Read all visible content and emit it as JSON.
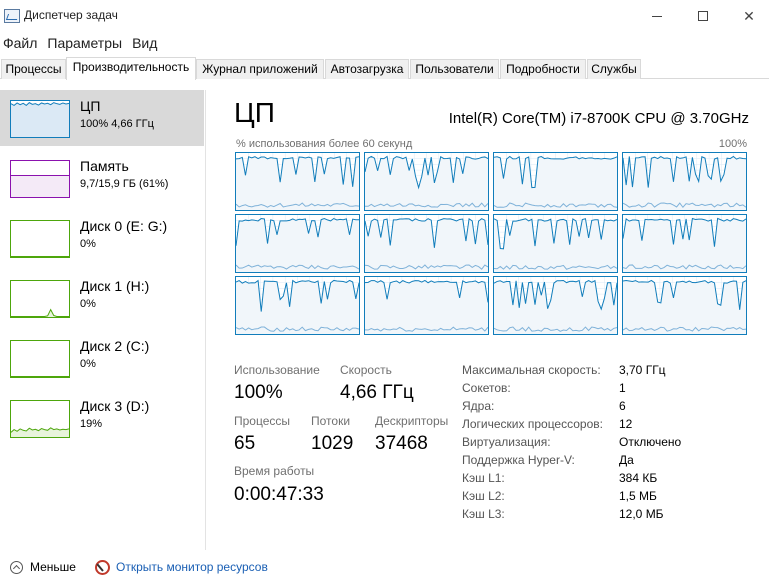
{
  "window": {
    "title": "Диспетчер задач",
    "minimize_icon": "minimize-icon",
    "maximize_icon": "maximize-icon",
    "close_icon": "close-icon",
    "close_glyph": "✕"
  },
  "menu": [
    "Файл",
    "Параметры",
    "Вид"
  ],
  "tabs": [
    {
      "label": "Процессы",
      "active": false
    },
    {
      "label": "Производительность",
      "active": true
    },
    {
      "label": "Журнал приложений",
      "active": false
    },
    {
      "label": "Автозагрузка",
      "active": false
    },
    {
      "label": "Пользователи",
      "active": false
    },
    {
      "label": "Подробности",
      "active": false
    },
    {
      "label": "Службы",
      "active": false
    }
  ],
  "sidebar": [
    {
      "title": "ЦП",
      "sub": "100% 4,66 ГГц",
      "kind": "cpu",
      "active": true,
      "color": "#117dbb",
      "trace": [
        0.95,
        0.9,
        0.97,
        0.92,
        0.96,
        0.9,
        0.98,
        0.93,
        0.95,
        0.91,
        0.97,
        0.94,
        0.96,
        0.92,
        0.98,
        0.95,
        0.93,
        0.97,
        0.94,
        0.96
      ]
    },
    {
      "title": "Память",
      "sub": "9,7/15,9 ГБ (61%)",
      "kind": "mem",
      "active": false,
      "color": "#8b12ae",
      "level": 0.61
    },
    {
      "title": "Диск 0 (E: G:)",
      "sub": "0%",
      "kind": "disk",
      "active": false,
      "color": "#4da60c",
      "trace": [
        0,
        0,
        0,
        0,
        0,
        0,
        0,
        0,
        0,
        0,
        0,
        0,
        0,
        0,
        0,
        0,
        0,
        0,
        0,
        0
      ]
    },
    {
      "title": "Диск 1 (H:)",
      "sub": "0%",
      "kind": "disk",
      "active": false,
      "color": "#4da60c",
      "trace": [
        0,
        0,
        0,
        0,
        0,
        0,
        0,
        0,
        0,
        0,
        0,
        0,
        0.02,
        0.2,
        0.03,
        0,
        0,
        0,
        0,
        0
      ]
    },
    {
      "title": "Диск 2 (C:)",
      "sub": "0%",
      "kind": "disk",
      "active": false,
      "color": "#4da60c",
      "trace": [
        0,
        0,
        0,
        0,
        0,
        0,
        0,
        0,
        0,
        0,
        0,
        0,
        0,
        0,
        0,
        0,
        0,
        0,
        0,
        0
      ]
    },
    {
      "title": "Диск 3 (D:)",
      "sub": "19%",
      "kind": "disk",
      "active": false,
      "color": "#4da60c",
      "trace": [
        0.12,
        0.2,
        0.15,
        0.22,
        0.18,
        0.16,
        0.24,
        0.19,
        0.21,
        0.17,
        0.23,
        0.2,
        0.18,
        0.25,
        0.2,
        0.22,
        0.19,
        0.21,
        0.2,
        0.22
      ]
    }
  ],
  "cpu": {
    "heading": "ЦП",
    "model": "Intel(R) Core(TM) i7-8700K CPU @ 3.70GHz",
    "graph_caption": "% использования более 60 секунд",
    "graph_max": "100%",
    "core_count": 12,
    "line_color": "#117dbb",
    "fill_color": "#f1f6fa"
  },
  "stats": {
    "usage_label": "Использование",
    "usage_value": "100%",
    "speed_label": "Скорость",
    "speed_value": "4,66 ГГц",
    "processes_label": "Процессы",
    "processes_value": "65",
    "threads_label": "Потоки",
    "threads_value": "1029",
    "handles_label": "Дескрипторы",
    "handles_value": "37468",
    "uptime_label": "Время работы",
    "uptime_value": "0:00:47:33"
  },
  "specs": [
    {
      "label": "Максимальная скорость:",
      "value": "3,70 ГГц"
    },
    {
      "label": "Сокетов:",
      "value": "1"
    },
    {
      "label": "Ядра:",
      "value": "6"
    },
    {
      "label": "Логических процессоров:",
      "value": "12"
    },
    {
      "label": "Виртуализация:",
      "value": "Отключено"
    },
    {
      "label": "Поддержка Hyper-V:",
      "value": "Да"
    },
    {
      "label": "Кэш L1:",
      "value": "384 КБ"
    },
    {
      "label": "Кэш L2:",
      "value": "1,5 МБ"
    },
    {
      "label": "Кэш L3:",
      "value": "12,0 МБ"
    }
  ],
  "footer": {
    "less_label": "Меньше",
    "monitor_link": "Открыть монитор ресурсов"
  }
}
